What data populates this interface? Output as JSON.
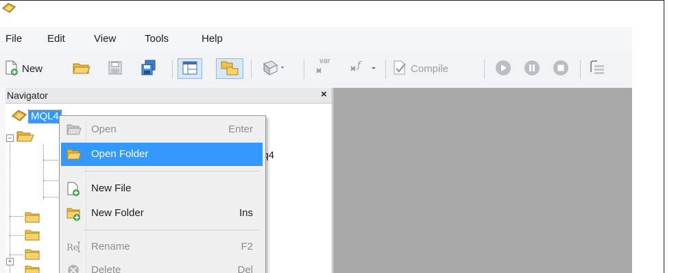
{
  "menubar": {
    "file": "File",
    "edit": "Edit",
    "view": "View",
    "tools": "Tools",
    "help": "Help"
  },
  "toolbar": {
    "new_label": "New",
    "var_label": "var",
    "compile_label": "Compile",
    "icons": [
      "new-file-icon",
      "open-folder-icon",
      "save-icon",
      "save-all-icon",
      "navigator-toggle-icon",
      "folder-toggle-icon",
      "book-icon",
      "insert-var-icon",
      "insert-function-icon",
      "compile-icon",
      "play-icon",
      "pause-icon",
      "stop-icon",
      "debug-icon"
    ]
  },
  "navigator": {
    "title": "Navigator",
    "close_label": "×",
    "root_label": "MQL4",
    "partial_file_text": "nq4"
  },
  "context_menu": {
    "items": [
      {
        "label": "Open",
        "shortcut": "Enter",
        "state": "disabled",
        "icon": "open-folder-icon"
      },
      {
        "label": "Open Folder",
        "shortcut": "",
        "state": "highlighted",
        "icon": "open-folder-icon"
      },
      {
        "label": "New File",
        "shortcut": "",
        "state": "normal",
        "icon": "new-file-icon"
      },
      {
        "label": "New Folder",
        "shortcut": "Ins",
        "state": "normal",
        "icon": "new-folder-icon"
      },
      {
        "label": "Rename",
        "shortcut": "F2",
        "state": "disabled",
        "icon": "rename-icon"
      },
      {
        "label": "Delete",
        "shortcut": "Del",
        "state": "disabled",
        "icon": "delete-icon"
      }
    ]
  },
  "colors": {
    "highlight": "#3399ff",
    "panel_bg": "#a9a9a9",
    "folder_yellow": "#f2c14e"
  }
}
